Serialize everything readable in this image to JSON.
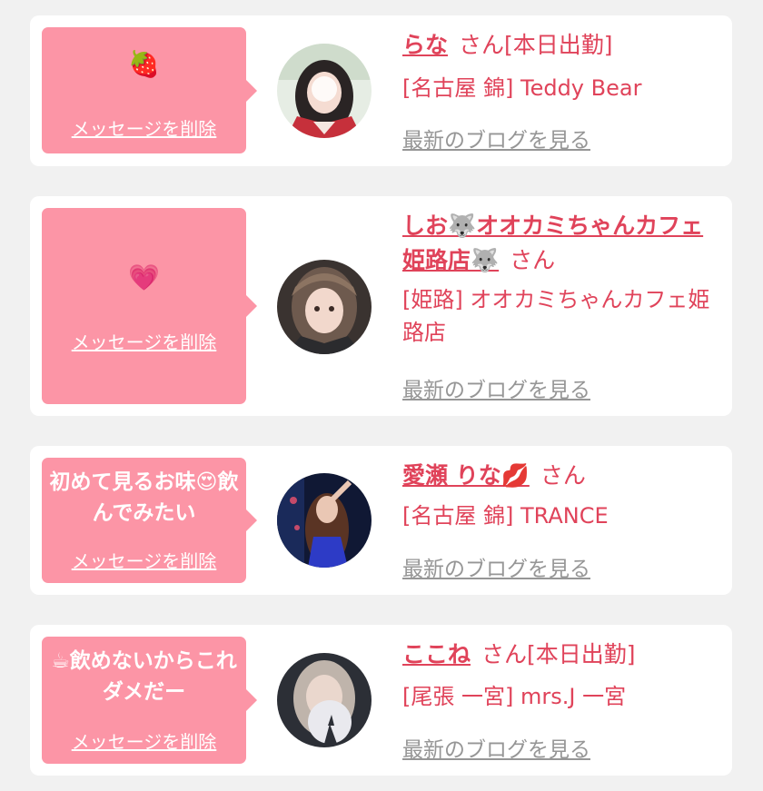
{
  "colors": {
    "background": "#f1f1f1",
    "card": "#ffffff",
    "bubble": "#fc95a6",
    "accent": "#e0435a",
    "muted": "#969696"
  },
  "items": [
    {
      "message": "🍓",
      "delete_label": "メッセージを削除",
      "name": "らな",
      "suffix": "さん[本日出勤]",
      "shop": "[名古屋 錦] Teddy Bear",
      "blog_link": "最新のブログを見る"
    },
    {
      "message": "💗",
      "delete_label": "メッセージを削除",
      "name": "しお🐺オオカミちゃんカフェ姫路店🐺",
      "suffix": "さん",
      "shop": "[姫路] オオカミちゃんカフェ姫路店",
      "blog_link": "最新のブログを見る"
    },
    {
      "message": "初めて見るお味😍飲んでみたい",
      "delete_label": "メッセージを削除",
      "name": "愛瀬 りな💋",
      "suffix": "さん",
      "shop": "[名古屋 錦] TRANCE",
      "blog_link": "最新のブログを見る"
    },
    {
      "message": "☕飲めないからこれダメだー",
      "delete_label": "メッセージを削除",
      "name": "ここね",
      "suffix": "さん[本日出勤]",
      "shop": "[尾張 一宮] mrs.J 一宮",
      "blog_link": "最新のブログを見る"
    }
  ]
}
